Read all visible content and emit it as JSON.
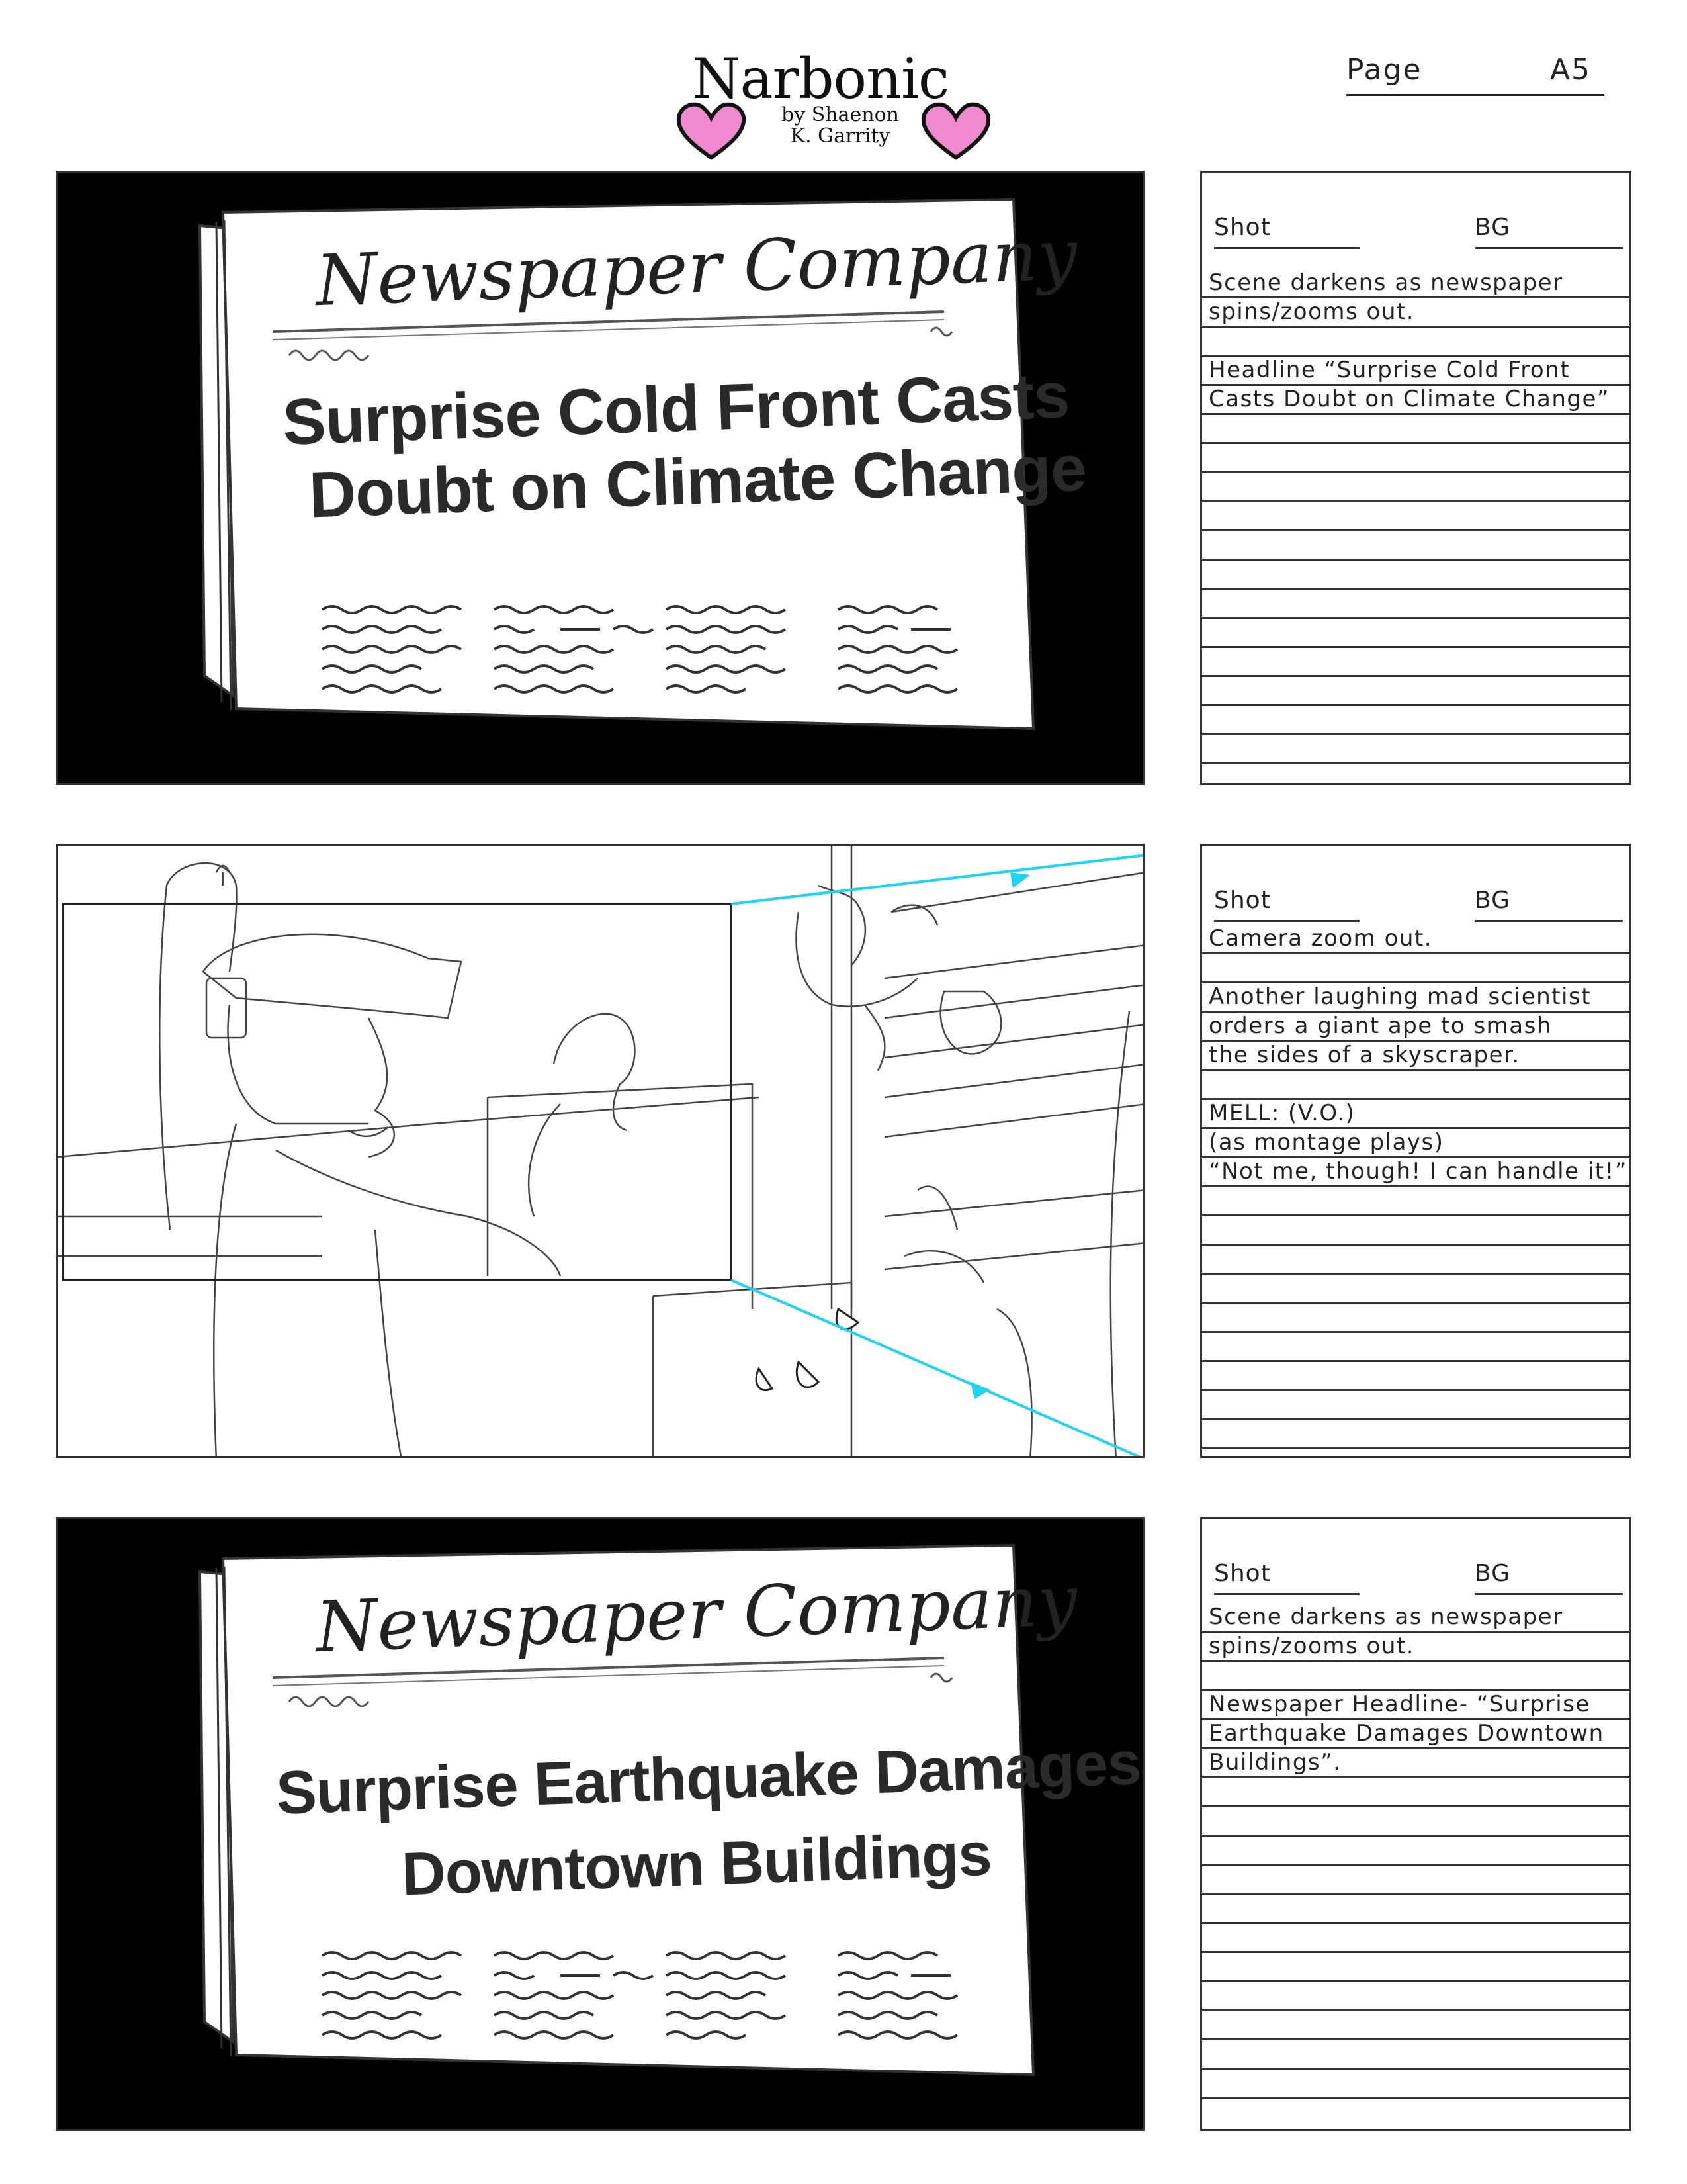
{
  "header": {
    "logo_title": "Narbonic",
    "logo_byline_1": "by Shaenon",
    "logo_byline_2": "K. Garrity",
    "page_label": "Page",
    "page_number": "A5",
    "heart_color": "#f08ad0"
  },
  "panels": [
    {
      "masthead": "Newspaper Company",
      "headline_1": "Surprise Cold Front Casts",
      "headline_2": "Doubt on Climate Change",
      "notes": {
        "shot_label": "Shot",
        "bg_label": "BG",
        "lines": [
          "Scene darkens as newspaper",
          "spins/zooms out.",
          "",
          "Headline “Surprise Cold Front",
          "Casts Doubt on Climate Change”",
          "",
          "",
          "",
          "",
          "",
          "",
          "",
          "",
          "",
          "",
          "",
          "",
          ""
        ]
      }
    },
    {
      "arrow_color": "#1ed4f0",
      "notes": {
        "shot_label": "Shot",
        "bg_label": "BG",
        "lines": [
          "Camera zoom out.",
          "",
          "Another laughing mad scientist",
          "orders a giant ape to smash",
          "the sides of a skyscraper.",
          "",
          "MELL: (V.O.)",
          "(as montage plays)",
          "“Not me, though! I can handle it!”",
          "",
          "",
          "",
          "",
          "",
          "",
          "",
          "",
          ""
        ]
      }
    },
    {
      "masthead": "Newspaper Company",
      "headline_1": "Surprise Earthquake Damages",
      "headline_2": "Downtown Buildings",
      "notes": {
        "shot_label": "Shot",
        "bg_label": "BG",
        "lines": [
          "Scene darkens as newspaper",
          "spins/zooms out.",
          "",
          "Newspaper Headline- “Surprise",
          "Earthquake Damages Downtown",
          "Buildings”.",
          "",
          "",
          "",
          "",
          "",
          "",
          "",
          "",
          "",
          "",
          "",
          ""
        ]
      }
    }
  ]
}
